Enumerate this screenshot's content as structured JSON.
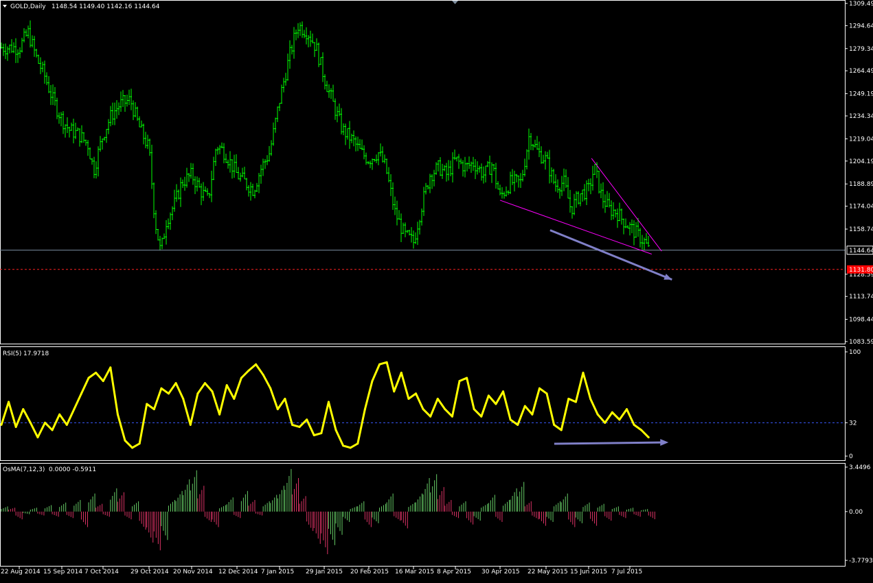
{
  "colors": {
    "background": "#000000",
    "frame": "#ffffff",
    "candle": "#00ff00",
    "rsi_line": "#ffff00",
    "osma_up": "#66cc66",
    "osma_down": "#dd3366",
    "bid_line": "#7f93a6",
    "target_line": "#ff2020",
    "target_label_bg": "#ff0000",
    "trendline": "#ff00ff",
    "arrow": "#8080c8",
    "level_line": "#3a5aff"
  },
  "chart_data": [
    {
      "type": "candlestick",
      "title": "GOLD,Daily",
      "ohlc_label": "1148.54 1149.40 1142.16 1144.64",
      "ylim": [
        1083.59,
        1309.49
      ],
      "y_ticks": [
        "1309.49",
        "1294.64",
        "1279.34",
        "1264.49",
        "1249.19",
        "1234.34",
        "1219.04",
        "1204.19",
        "1188.89",
        "1174.04",
        "1158.74",
        "1128.59",
        "1113.74",
        "1098.44",
        "1083.59"
      ],
      "current_price": "1144.64",
      "current_price_value": 1144.64,
      "target_price": "1131.80",
      "target_price_value": 1131.8,
      "x_tick_labels": [
        "22 Aug 2014",
        "15 Sep 2014",
        "7 Oct 2014",
        "29 Oct 2014",
        "20 Nov 2014",
        "12 Dec 2014",
        "7 Jan 2015",
        "29 Jan 2015",
        "20 Feb 2015",
        "16 Mar 2015",
        "8 Apr 2015",
        "30 Apr 2015",
        "22 May 2015",
        "15 Jun 2015",
        "7 Jul 2015"
      ],
      "close_path": [
        [
          "22 Aug 2014",
          1280
        ],
        [
          "27 Aug 2014",
          1290
        ],
        [
          "1 Sep 2014",
          1272
        ],
        [
          "5 Sep 2014",
          1262
        ],
        [
          "10 Sep 2014",
          1245
        ],
        [
          "15 Sep 2014",
          1232
        ],
        [
          "19 Sep 2014",
          1225
        ],
        [
          "24 Sep 2014",
          1222
        ],
        [
          "29 Sep 2014",
          1215
        ],
        [
          "2 Oct 2014",
          1198
        ],
        [
          "7 Oct 2014",
          1222
        ],
        [
          "11 Oct 2014",
          1235
        ],
        [
          "15 Oct 2014",
          1242
        ],
        [
          "20 Oct 2014",
          1245
        ],
        [
          "24 Oct 2014",
          1228
        ],
        [
          "29 Oct 2014",
          1212
        ],
        [
          "1 Nov 2014",
          1165
        ],
        [
          "4 Nov 2014",
          1143
        ],
        [
          "7 Nov 2014",
          1165
        ],
        [
          "11 Nov 2014",
          1175
        ],
        [
          "15 Nov 2014",
          1190
        ],
        [
          "20 Nov 2014",
          1195
        ],
        [
          "24 Nov 2014",
          1185
        ],
        [
          "28 Nov 2014",
          1178
        ],
        [
          "2 Dec 2014",
          1215
        ],
        [
          "6 Dec 2014",
          1210
        ],
        [
          "12 Dec 2014",
          1195
        ],
        [
          "17 Dec 2014",
          1190
        ],
        [
          "22 Dec 2014",
          1185
        ],
        [
          "27 Dec 2014",
          1200
        ],
        [
          "1 Jan 2015",
          1210
        ],
        [
          "7 Jan 2015",
          1245
        ],
        [
          "12 Jan 2015",
          1275
        ],
        [
          "16 Jan 2015",
          1295
        ],
        [
          "21 Jan 2015",
          1290
        ],
        [
          "25 Jan 2015",
          1280
        ],
        [
          "29 Jan 2015",
          1260
        ],
        [
          "3 Feb 2015",
          1240
        ],
        [
          "7 Feb 2015",
          1225
        ],
        [
          "12 Feb 2015",
          1218
        ],
        [
          "16 Feb 2015",
          1210
        ],
        [
          "20 Feb 2015",
          1205
        ],
        [
          "25 Feb 2015",
          1210
        ],
        [
          "1 Mar 2015",
          1200
        ],
        [
          "6 Mar 2015",
          1170
        ],
        [
          "11 Mar 2015",
          1155
        ],
        [
          "16 Mar 2015",
          1150
        ],
        [
          "20 Mar 2015",
          1172
        ],
        [
          "25 Mar 2015",
          1195
        ],
        [
          "30 Mar 2015",
          1200
        ],
        [
          "3 Apr 2015",
          1195
        ],
        [
          "8 Apr 2015",
          1205
        ],
        [
          "13 Apr 2015",
          1200
        ],
        [
          "17 Apr 2015",
          1203
        ],
        [
          "22 Apr 2015",
          1195
        ],
        [
          "26 Apr 2015",
          1202
        ],
        [
          "30 Apr 2015",
          1180
        ],
        [
          "5 May 2015",
          1190
        ],
        [
          "10 May 2015",
          1190
        ],
        [
          "14 May 2015",
          1222
        ],
        [
          "18 May 2015",
          1210
        ],
        [
          "22 May 2015",
          1205
        ],
        [
          "27 May 2015",
          1188
        ],
        [
          "1 Jun 2015",
          1190
        ],
        [
          "5 Jun 2015",
          1172
        ],
        [
          "10 Jun 2015",
          1182
        ],
        [
          "15 Jun 2015",
          1185
        ],
        [
          "18 Jun 2015",
          1200
        ],
        [
          "22 Jun 2015",
          1180
        ],
        [
          "26 Jun 2015",
          1172
        ],
        [
          "30 Jun 2015",
          1170
        ],
        [
          "3 Jul 2015",
          1165
        ],
        [
          "7 Jul 2015",
          1160
        ],
        [
          "11 Jul 2015",
          1155
        ],
        [
          "15 Jul 2015",
          1150
        ],
        [
          "17 Jul 2015",
          1144.64
        ]
      ]
    },
    {
      "type": "line",
      "title": "RSI(5)",
      "value_label": "17.9718",
      "ylim": [
        0,
        100
      ],
      "y_ticks": [
        "100",
        "32",
        "0"
      ],
      "level": 32,
      "values": [
        30,
        52,
        28,
        45,
        32,
        18,
        32,
        25,
        40,
        30,
        45,
        60,
        75,
        80,
        72,
        85,
        40,
        15,
        8,
        12,
        50,
        45,
        65,
        60,
        70,
        55,
        30,
        60,
        70,
        62,
        40,
        68,
        55,
        75,
        82,
        88,
        78,
        65,
        45,
        55,
        30,
        28,
        35,
        20,
        22,
        52,
        25,
        10,
        8,
        12,
        45,
        72,
        88,
        90,
        62,
        80,
        55,
        60,
        45,
        38,
        55,
        45,
        38,
        72,
        75,
        45,
        38,
        58,
        50,
        62,
        35,
        30,
        48,
        40,
        65,
        60,
        30,
        25,
        55,
        52,
        80,
        55,
        40,
        32,
        42,
        35,
        45,
        30,
        25,
        18
      ]
    },
    {
      "type": "bar",
      "title": "OsMA(7,12,3)",
      "value_label": "0.0000 -0.5911",
      "ylim": [
        -3.7793,
        3.4496
      ],
      "y_ticks": [
        "3.4496",
        "0.00",
        "-3.7793"
      ],
      "values": [
        0.4,
        0.3,
        -0.6,
        -0.2,
        0.3,
        -0.3,
        0.5,
        -0.4,
        0.7,
        -0.5,
        0.9,
        -1.2,
        1.4,
        0.6,
        -0.4,
        1.8,
        1.5,
        -0.6,
        0.8,
        -1.4,
        -2.4,
        -3.0,
        -2.2,
        0.9,
        1.6,
        2.5,
        3.2,
        2.0,
        -0.8,
        -1.2,
        0.5,
        1.1,
        -0.5,
        1.6,
        0.9,
        -0.3,
        0.8,
        1.3,
        2.0,
        3.3,
        2.6,
        1.2,
        -1.5,
        -2.5,
        -3.3,
        -2.6,
        -1.8,
        -0.8,
        0.4,
        0.8,
        -1.2,
        -0.9,
        0.6,
        1.4,
        -0.7,
        -1.3,
        0.7,
        1.4,
        2.6,
        2.9,
        1.9,
        0.9,
        -0.5,
        0.8,
        -1.0,
        -0.7,
        0.6,
        1.3,
        -0.8,
        0.9,
        1.8,
        2.3,
        0.8,
        -0.6,
        -1.1,
        -0.8,
        0.8,
        1.4,
        -1.2,
        -0.9,
        0.7,
        -1.1,
        0.6,
        -0.7,
        0.4,
        -0.5,
        0.3,
        -0.4,
        0.2,
        -0.5911
      ]
    }
  ]
}
